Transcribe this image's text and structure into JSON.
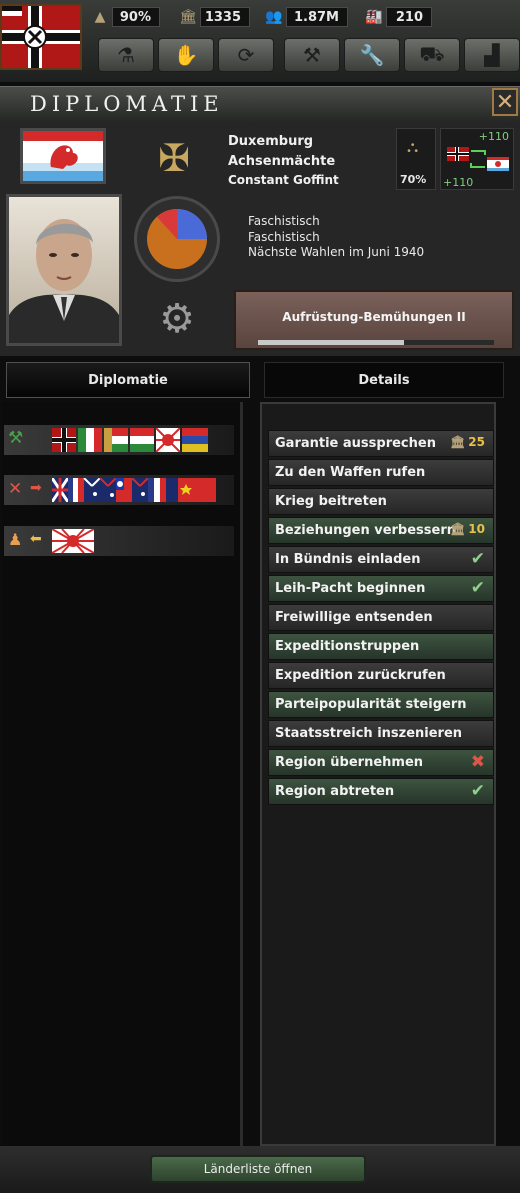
{
  "topbar": {
    "stability": "90%",
    "political_power": "1335",
    "manpower": "1.87M",
    "factories": "210"
  },
  "header": {
    "title": "Diplomatie"
  },
  "country": {
    "name": "Duxemburg",
    "faction": "Achsenmächte",
    "leader": "Constant Goffint",
    "opinion": "70%",
    "relation_top": "+110",
    "relation_bottom": "+110",
    "ideology1": "Faschistisch",
    "ideology2": "Faschistisch",
    "elections": "Nächste Wahlen im Juni 1940",
    "focus": "Aufrüstung-Bemühungen II",
    "focus_progress": 0.62
  },
  "tabs": {
    "diplomacy": "Diplomatie",
    "details": "Details"
  },
  "actions": [
    {
      "label": "Garantie aussprechen",
      "style": "gray",
      "cost": "25"
    },
    {
      "label": "Zu den Waffen rufen",
      "style": "gray"
    },
    {
      "label": "Krieg beitreten",
      "style": "gray"
    },
    {
      "label": "Beziehungen verbessern",
      "style": "green",
      "cost": "10"
    },
    {
      "label": "In Bündnis einladen",
      "style": "gray",
      "status": "check"
    },
    {
      "label": "Leih-Pacht beginnen",
      "style": "green",
      "status": "check"
    },
    {
      "label": "Freiwillige entsenden",
      "style": "gray"
    },
    {
      "label": "Expeditionstruppen",
      "style": "green"
    },
    {
      "label": "Expedition zurückrufen",
      "style": "gray"
    },
    {
      "label": "Parteipopularität steigern",
      "style": "green"
    },
    {
      "label": "Staatsstreich inszenieren",
      "style": "gray"
    },
    {
      "label": "Region übernehmen",
      "style": "green",
      "status": "cross"
    },
    {
      "label": "Region abtreten",
      "style": "green",
      "status": "check"
    }
  ],
  "footer": {
    "open_list": "Länderliste öffnen"
  },
  "colors": {
    "check": "#8fd08f",
    "cross": "#e05545",
    "cost": "#e8c04a"
  }
}
